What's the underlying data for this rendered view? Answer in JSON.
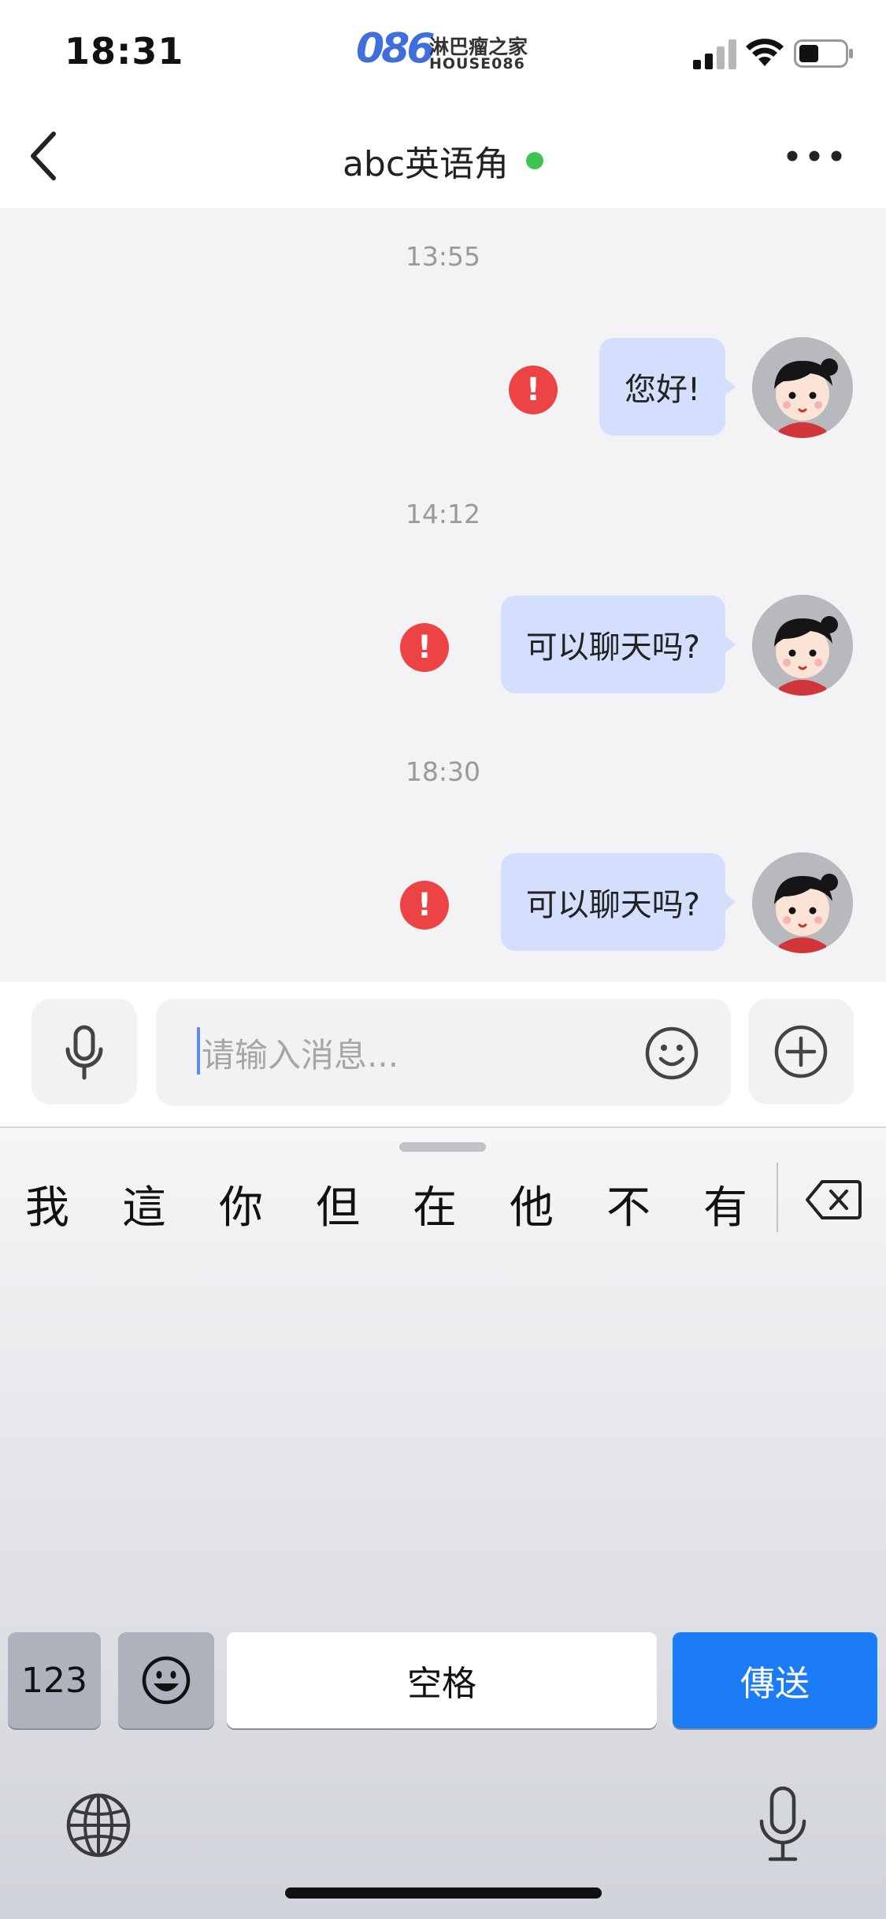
{
  "status_bar": {
    "time": "18:31",
    "watermark_digits": "086",
    "watermark_cn": "淋巴瘤之家",
    "watermark_en": "HOUSE086"
  },
  "nav": {
    "title": "abc英语角",
    "online_color": "#3cc651"
  },
  "messages": [
    {
      "timestamp": "13:55",
      "text": "您好!",
      "status": "failed"
    },
    {
      "timestamp": "14:12",
      "text": "可以聊天吗?",
      "status": "failed"
    },
    {
      "timestamp": "18:30",
      "text": "可以聊天吗?",
      "status": "failed"
    }
  ],
  "input": {
    "placeholder": "请输入消息..."
  },
  "keyboard": {
    "candidates": [
      "我",
      "這",
      "你",
      "但",
      "在",
      "他",
      "不",
      "有"
    ],
    "key_123": "123",
    "space_label": "空格",
    "send_label": "傳送",
    "send_color": "#1b7cf5"
  }
}
